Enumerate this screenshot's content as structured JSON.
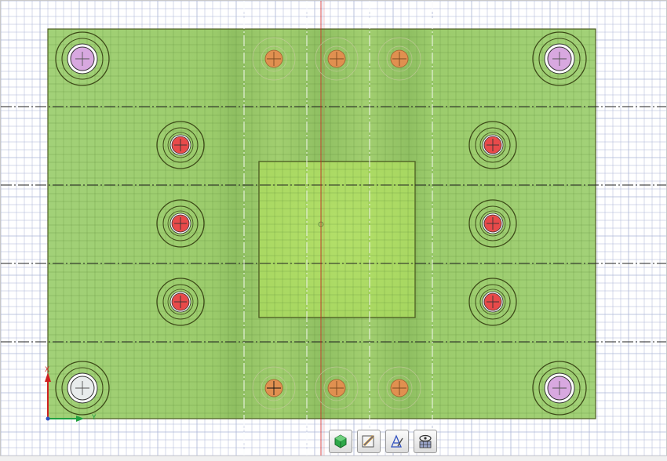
{
  "viewport": {
    "name": "cad-top-view",
    "plate_color": "#9ccd6c",
    "center_block_color": "#a8d860",
    "grid_color": "#aab4d6",
    "centerline_color": "#222222",
    "center_axis_color": "#d02020"
  },
  "axis_triad": {
    "x_label": "Y",
    "y_label": "X",
    "x_color": "#20a040",
    "y_color": "#d02020"
  },
  "holes": {
    "guide_pins": [
      "purple",
      "purple",
      "white",
      "purple"
    ],
    "return_pins": 6,
    "ejector_pins": 6,
    "colors": {
      "purple": "#d8a8e0",
      "white": "#e8ecec",
      "red": "#e84a4a",
      "orange": "#e09050"
    }
  },
  "toolbar": {
    "buttons": [
      {
        "name": "3d-view-button",
        "icon": "green-cube-icon"
      },
      {
        "name": "edit-sketch-button",
        "icon": "pencil-ruler-icon"
      },
      {
        "name": "annotate-button",
        "icon": "text-annotation-icon"
      },
      {
        "name": "visibility-button",
        "icon": "eye-grid-icon"
      }
    ]
  }
}
